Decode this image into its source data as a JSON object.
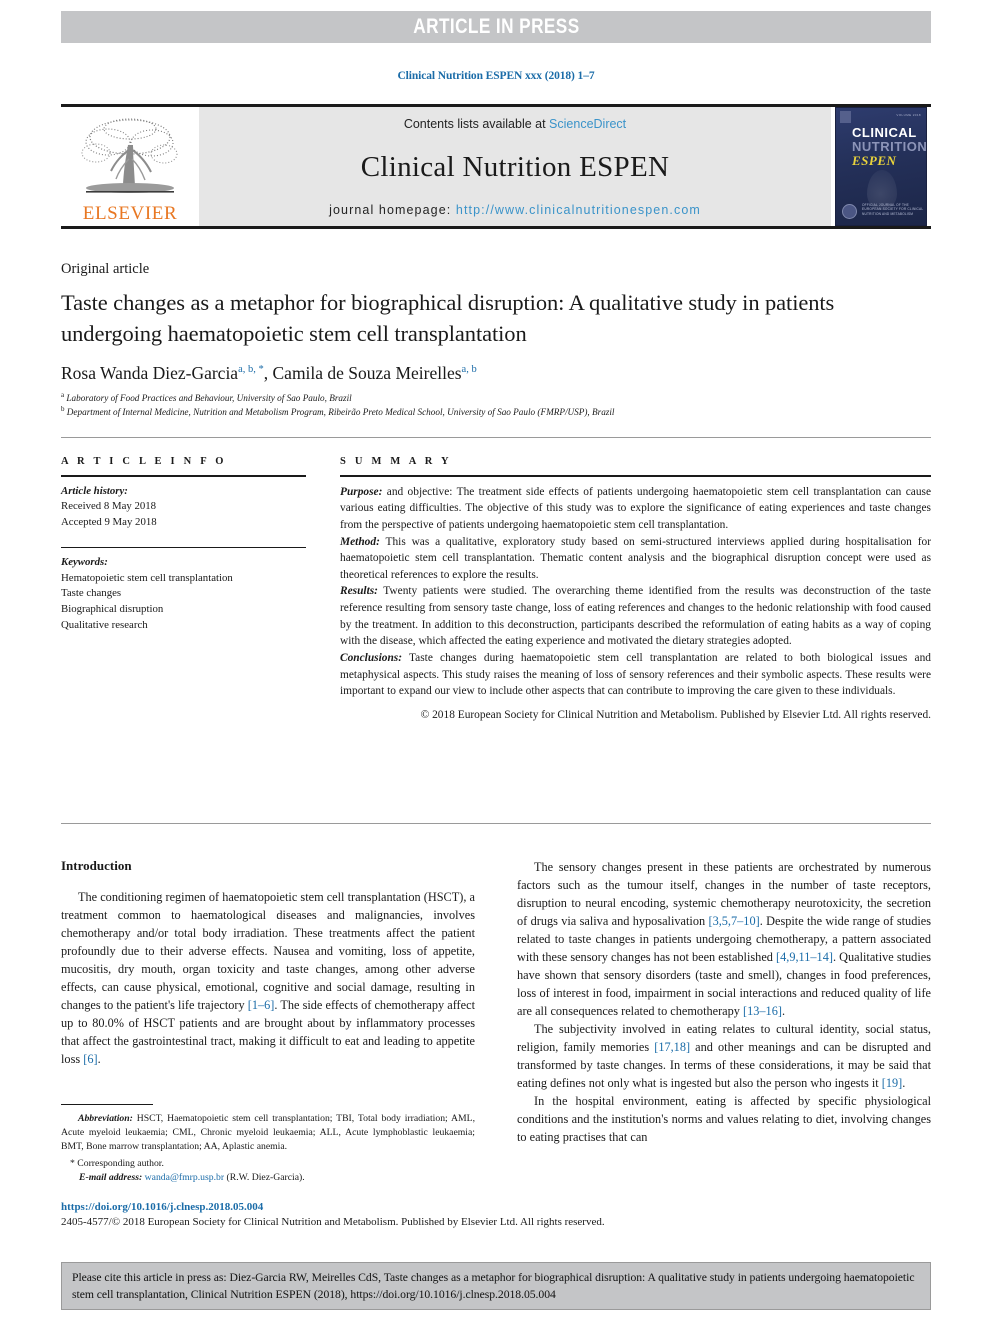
{
  "banner": {
    "text": "ARTICLE IN PRESS"
  },
  "running_head": {
    "text": "Clinical Nutrition ESPEN xxx (2018) 1–7"
  },
  "masthead": {
    "publisher_word": "ELSEVIER",
    "contents_prefix": "Contents lists available at ",
    "contents_link": "ScienceDirect",
    "journal_title": "Clinical Nutrition ESPEN",
    "homepage_prefix": "journal homepage: ",
    "homepage_url": "http://www.clinicalnutritionespen.com",
    "cover": {
      "line1": "CLINICAL",
      "line2": "NUTRITION",
      "line3": "ESPEN",
      "corner_note": "VOLUME 2018",
      "footer_note": "OFFICIAL JOURNAL OF THE EUROPEAN SOCIETY FOR CLINICAL NUTRITION AND METABOLISM"
    },
    "accent_link_color": "#3a93c9",
    "elsevier_orange": "#e87722"
  },
  "article_type": "Original article",
  "title": "Taste changes as a metaphor for biographical disruption: A qualitative study in patients undergoing haematopoietic stem cell transplantation",
  "authors": [
    {
      "name": "Rosa Wanda Diez-Garcia",
      "marks": "a, b, *"
    },
    {
      "name": "Camila de Souza Meirelles",
      "marks": "a, b"
    }
  ],
  "affiliations": [
    {
      "mark": "a",
      "text": "Laboratory of Food Practices and Behaviour, University of Sao Paulo, Brazil"
    },
    {
      "mark": "b",
      "text": "Department of Internal Medicine, Nutrition and Metabolism Program, Ribeirão Preto Medical School, University of Sao Paulo (FMRP/USP), Brazil"
    }
  ],
  "article_info": {
    "heading": "A R T I C L E  I N F O",
    "history_label": "Article history:",
    "history": [
      "Received 8 May 2018",
      "Accepted 9 May 2018"
    ],
    "keywords_label": "Keywords:",
    "keywords": [
      "Hematopoietic stem cell transplantation",
      "Taste changes",
      "Biographical disruption",
      "Qualitative research"
    ]
  },
  "summary": {
    "heading": "S U M M A R Y",
    "sections": [
      {
        "label": "Purpose:",
        "text": " and objective: The treatment side effects of patients undergoing haematopoietic stem cell transplantation can cause various eating difficulties. The objective of this study was to explore the significance of eating experiences and taste changes from the perspective of patients undergoing haematopoietic stem cell transplantation."
      },
      {
        "label": "Method:",
        "text": " This was a qualitative, exploratory study based on semi-structured interviews applied during hospitalisation for haematopoietic stem cell transplantation. Thematic content analysis and the biographical disruption concept were used as theoretical references to explore the results."
      },
      {
        "label": "Results:",
        "text": " Twenty patients were studied. The overarching theme identified from the results was deconstruction of the taste reference resulting from sensory taste change, loss of eating references and changes to the hedonic relationship with food caused by the treatment. In addition to this deconstruction, participants described the reformulation of eating habits as a way of coping with the disease, which affected the eating experience and motivated the dietary strategies adopted."
      },
      {
        "label": "Conclusions:",
        "text": " Taste changes during haematopoietic stem cell transplantation are related to both biological issues and metaphysical aspects. This study raises the meaning of loss of sensory references and their symbolic aspects. These results were important to expand our view to include other aspects that can contribute to improving the care given to these individuals."
      }
    ],
    "copyright": "© 2018 European Society for Clinical Nutrition and Metabolism. Published by Elsevier Ltd. All rights reserved."
  },
  "body": {
    "left_heading": "Introduction",
    "left_paragraphs": [
      {
        "parts": [
          {
            "t": "The conditioning regimen of haematopoietic stem cell transplantation (HSCT), a treatment common to haematological diseases and malignancies, involves chemotherapy and/or total body irradiation. These treatments affect the patient profoundly due to their adverse effects. Nausea and vomiting, loss of appetite, mucositis, dry mouth, organ toxicity and taste changes, among other adverse effects, can cause physical, emotional, cognitive and social damage, resulting in changes to the patient's life trajectory "
          },
          {
            "t": "[1–6]",
            "ref": true
          },
          {
            "t": ". The side effects of chemotherapy affect up to 80.0% of HSCT patients and are brought about by inflammatory processes that affect the gastrointestinal tract, making it difficult to eat and leading to appetite loss "
          },
          {
            "t": "[6]",
            "ref": true
          },
          {
            "t": "."
          }
        ]
      }
    ],
    "right_paragraphs": [
      {
        "parts": [
          {
            "t": "The sensory changes present in these patients are orchestrated by numerous factors such as the tumour itself, changes in the number of taste receptors, disruption to neural encoding, systemic chemotherapy neurotoxicity, the secretion of drugs via saliva and hyposalivation "
          },
          {
            "t": "[3,5,7–10]",
            "ref": true
          },
          {
            "t": ". Despite the wide range of studies related to taste changes in patients undergoing chemotherapy, a pattern associated with these sensory changes has not been established "
          },
          {
            "t": "[4,9,11–14]",
            "ref": true
          },
          {
            "t": ". Qualitative studies have shown that sensory disorders (taste and smell), changes in food preferences, loss of interest in food, impairment in social interactions and reduced quality of life are all consequences related to chemotherapy "
          },
          {
            "t": "[13–16]",
            "ref": true
          },
          {
            "t": "."
          }
        ]
      },
      {
        "parts": [
          {
            "t": "The subjectivity involved in eating relates to cultural identity, social status, religion, family memories "
          },
          {
            "t": "[17,18]",
            "ref": true
          },
          {
            "t": " and other meanings and can be disrupted and transformed by taste changes. In terms of these considerations, it may be said that eating defines not only what is ingested but also the person who ingests it "
          },
          {
            "t": "[19]",
            "ref": true
          },
          {
            "t": "."
          }
        ]
      },
      {
        "parts": [
          {
            "t": "In the hospital environment, eating is affected by specific physiological conditions and the institution's norms and values relating to diet, involving changes to eating practises that can"
          }
        ]
      }
    ]
  },
  "footnote": {
    "abbrev_label": "Abbreviation:",
    "abbrev_text": " HSCT, Haematopoietic stem cell transplantation; TBI, Total body irradiation; AML, Acute myeloid leukaemia; CML, Chronic myeloid leukaemia; ALL, Acute lymphoblastic leukaemia; BMT, Bone marrow transplantation; AA, Aplastic anemia.",
    "corresponding": "Corresponding author.",
    "email_label": "E-mail address:",
    "email": "wanda@fmrp.usp.br",
    "email_suffix": " (R.W. Diez-Garcia)."
  },
  "doi": "https://doi.org/10.1016/j.clnesp.2018.05.004",
  "issn_line": "2405-4577/© 2018 European Society for Clinical Nutrition and Metabolism. Published by Elsevier Ltd. All rights reserved.",
  "cite_box": {
    "text": "Please cite this article in press as: Diez-Garcia RW, Meirelles CdS, Taste changes as a metaphor for biographical disruption: A qualitative study in patients undergoing haematopoietic stem cell transplantation, Clinical Nutrition ESPEN (2018), https://doi.org/10.1016/j.clnesp.2018.05.004"
  }
}
